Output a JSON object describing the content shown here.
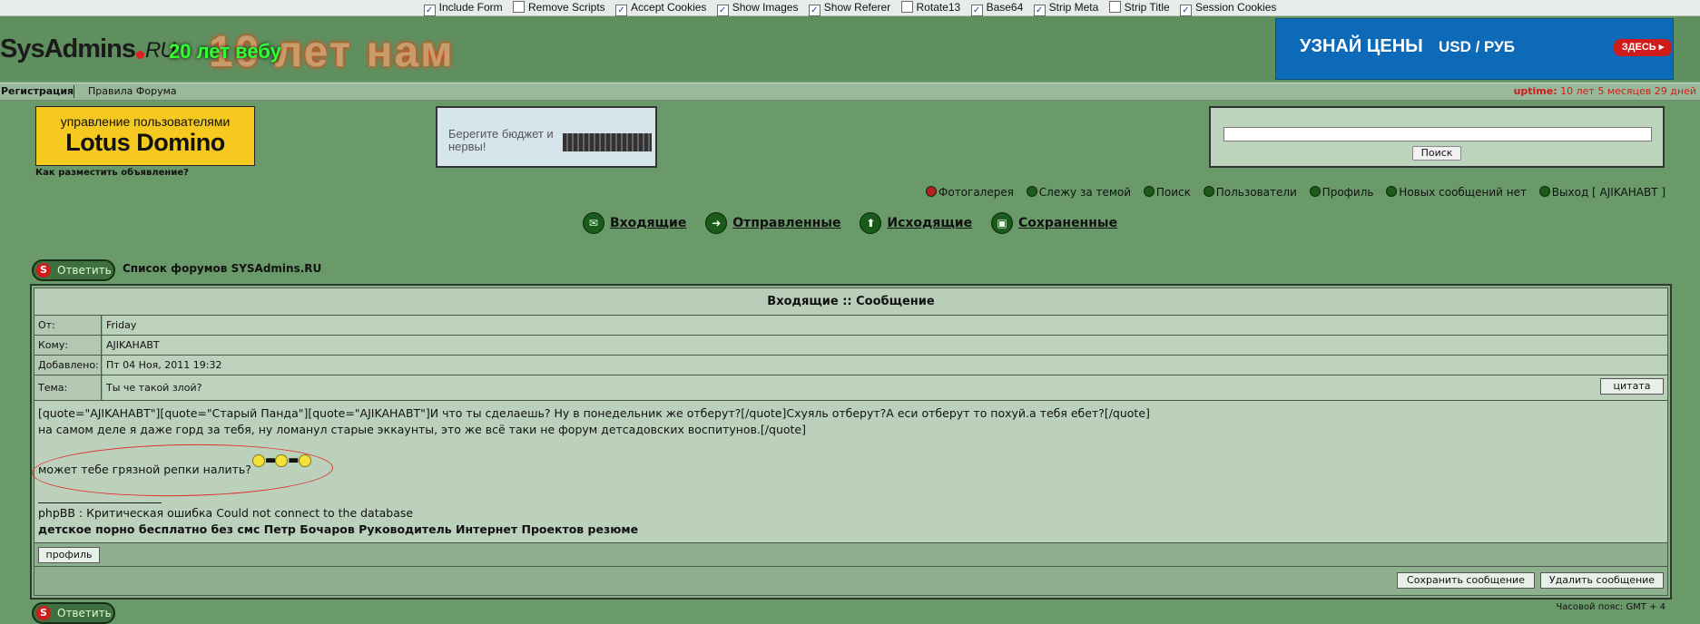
{
  "proxy_options": [
    {
      "label": "Include Form",
      "checked": true
    },
    {
      "label": "Remove Scripts",
      "checked": false
    },
    {
      "label": "Accept Cookies",
      "checked": true
    },
    {
      "label": "Show Images",
      "checked": true
    },
    {
      "label": "Show Referer",
      "checked": true
    },
    {
      "label": "Rotate13",
      "checked": false
    },
    {
      "label": "Base64",
      "checked": true
    },
    {
      "label": "Strip Meta",
      "checked": true
    },
    {
      "label": "Strip Title",
      "checked": false
    },
    {
      "label": "Session Cookies",
      "checked": true
    }
  ],
  "header": {
    "logo_text": "SysAdmins",
    "logo_ru": "RU",
    "anniv_small": "20 лет вебу",
    "anniv_big": "10 лет нам",
    "ad": {
      "title": "УЗНАЙ ЦЕНЫ",
      "pair": "USD / РУБ",
      "button": "ЗДЕСЬ ▸"
    }
  },
  "navstrip": {
    "register": "Регистрация",
    "rules": "Правила Форума",
    "uptime_label": "uptime:",
    "uptime_value": "10 лет 5 месяцев 29 дней"
  },
  "ads": {
    "lotus_line1": "управление пользователями",
    "lotus_line2": "Lotus Domino",
    "how_to": "Как разместить объявление?",
    "budget_text": "Берегите бюджет и нервы!"
  },
  "search": {
    "input_value": "",
    "button": "Поиск"
  },
  "links": [
    {
      "label": "Фотогалерея",
      "icon": "red"
    },
    {
      "label": "Слежу за темой",
      "icon": "green"
    },
    {
      "label": "Поиск",
      "icon": "green"
    },
    {
      "label": "Пользователи",
      "icon": "green"
    },
    {
      "label": "Профиль",
      "icon": "green"
    },
    {
      "label": "Новых сообщений нет",
      "icon": "green"
    },
    {
      "label": "Выход [ AJIKAHABT ]",
      "icon": "green"
    }
  ],
  "tabs": [
    {
      "label": "Входящие",
      "icon": "inbox-icon",
      "glyph": "✉"
    },
    {
      "label": "Отправленные",
      "icon": "sent-icon",
      "glyph": "➜"
    },
    {
      "label": "Исходящие",
      "icon": "outbox-icon",
      "glyph": "⬆"
    },
    {
      "label": "Сохраненные",
      "icon": "saved-icon",
      "glyph": "▣"
    }
  ],
  "reply": {
    "label": "Ответить",
    "forum_list": "Список форумов SYSAdmins.RU"
  },
  "message": {
    "title": "Входящие :: Сообщение",
    "from_label": "От:",
    "from_value": "Friday",
    "to_label": "Кому:",
    "to_value": "AJIKAHABT",
    "date_label": "Добавлено:",
    "date_value": "Пт 04 Ноя, 2011 19:32",
    "subject_label": "Тема:",
    "subject_value": "Ты че такой злой?",
    "quote_button": "цитата",
    "body_line1": "[quote=\"AJIKAHABT\"][quote=\"Старый Панда\"][quote=\"AJIKAHABT\"]И что ты сделаешь? Ну в понедельник же отберут?[/quote]Схуяль отберут?А еси отберут то похуй.а тебя ебет?[/quote]",
    "body_line2": "на самом деле я даже горд за тебя, ну ломанул старые эккаунты, это же всё таки не форум детсадовских воспитунов.[/quote]",
    "body_line3": "может тебе грязной репки налить?",
    "sig_line1": "phpBB : Критическая ошибка Could not connect to the database",
    "sig_link": "детское порно бесплатно без смс Петр Бочаров Руководитель Интернет Проектов резюме",
    "profile_button": "профиль",
    "save_button": "Сохранить сообщение",
    "delete_button": "Удалить сообщение"
  },
  "timezone": "Часовой пояс: GMT + 4"
}
